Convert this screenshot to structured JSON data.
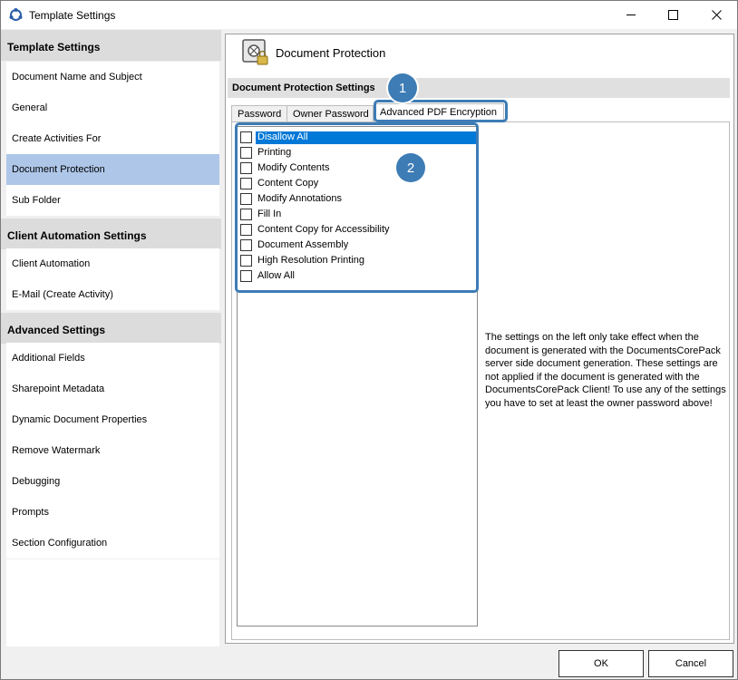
{
  "window": {
    "title": "Template Settings"
  },
  "sidebar": {
    "sections": [
      {
        "header": "Template Settings",
        "items": [
          "Document Name and Subject",
          "General",
          "Create Activities For",
          "Document Protection",
          "Sub Folder"
        ]
      },
      {
        "header": "Client Automation Settings",
        "items": [
          "Client Automation",
          "E-Mail (Create Activity)"
        ]
      },
      {
        "header": "Advanced Settings",
        "items": [
          "Additional Fields",
          "Sharepoint Metadata",
          "Dynamic Document Properties",
          "Remove Watermark",
          "Debugging",
          "Prompts",
          "Section Configuration"
        ]
      }
    ],
    "selected": "Document Protection"
  },
  "main": {
    "page_title": "Document Protection",
    "settings_header": "Document Protection Settings",
    "tabs": [
      "Password",
      "Owner Password",
      "Advanced PDF Encryption"
    ],
    "active_tab": "Advanced PDF Encryption",
    "permissions": [
      {
        "label": "Disallow All",
        "checked": false,
        "selected": true
      },
      {
        "label": "Printing",
        "checked": false
      },
      {
        "label": "Modify Contents",
        "checked": false
      },
      {
        "label": "Content Copy",
        "checked": false
      },
      {
        "label": "Modify Annotations",
        "checked": false
      },
      {
        "label": "Fill In",
        "checked": false
      },
      {
        "label": "Content Copy for Accessibility",
        "checked": false
      },
      {
        "label": "Document Assembly",
        "checked": false
      },
      {
        "label": "High Resolution Printing",
        "checked": false
      },
      {
        "label": "Allow All",
        "checked": false
      }
    ],
    "info_text": "The settings on the left only take effect when the document is generated with the DocumentsCorePack server side document generation. These settings are not applied if the document is generated with the DocumentsCorePack Client! To use any of the settings you have to set at least the owner password above!"
  },
  "callouts": [
    "1",
    "2"
  ],
  "buttons": {
    "ok": "OK",
    "cancel": "Cancel"
  },
  "colors": {
    "accent": "#3d7cb5",
    "selection": "#0078d7",
    "sidebar_selected": "#aec6e8"
  }
}
